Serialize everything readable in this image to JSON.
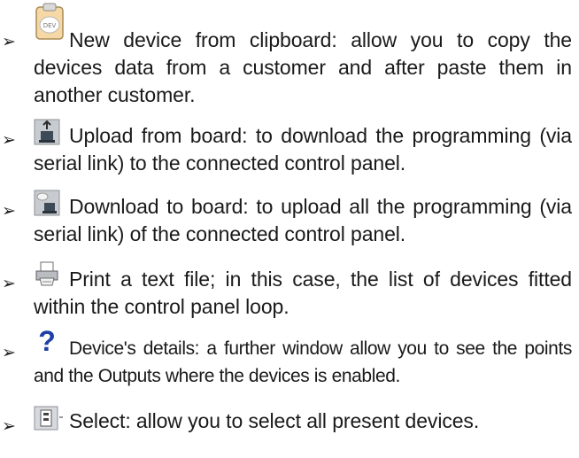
{
  "bullet_glyph": "➢",
  "items": [
    {
      "icon": "clipboard-icon",
      "text": "New device from clipboard: allow you to copy the devices data from a customer and after  paste them in another customer."
    },
    {
      "icon": "upload-from-board-icon",
      "text": "Upload from board: to download the programming (via serial link) to the connected control panel."
    },
    {
      "icon": "download-to-board-icon",
      "text": "Download to board:  to upload all the programming (via serial link) of the connected control panel."
    },
    {
      "icon": "printer-icon",
      "text": "Print a text file; in this case, the list of devices fitted within the control panel loop."
    },
    {
      "icon": "question-mark-icon",
      "text": "Device's details: a further window allow you to see the points and the Outputs where the devices is enabled."
    },
    {
      "icon": "select-icon",
      "text": "Select: allow you to select all present devices."
    }
  ]
}
